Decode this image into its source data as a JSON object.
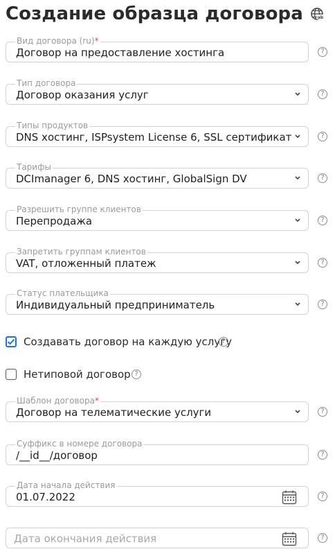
{
  "page_title": "Создание образца договора",
  "fields": [
    {
      "label": "Вид договора (ru)",
      "required": "*",
      "value": "Договор на предоставление хостинга",
      "type": "text"
    },
    {
      "label": "Тип договора",
      "value": "Договор оказания услуг",
      "type": "select"
    },
    {
      "label": "Типы продуктов",
      "value": "DNS хостинг, ISPsystem License 6, SSL сертификат",
      "type": "select"
    },
    {
      "label": "Тарифы",
      "value": "DCImanager 6, DNS хостинг, GlobalSign DV",
      "type": "select"
    },
    {
      "label": "Разрешить группе клиентов",
      "value": "Перепродажа",
      "type": "select"
    },
    {
      "label": "Запретить группам клиентов",
      "value": "VAT, отложенный платеж",
      "type": "select"
    },
    {
      "label": "Статус плательщика",
      "value": "Индивидуальный предприниматель",
      "type": "select"
    }
  ],
  "checkboxes": [
    {
      "label": "Создавать договор на каждую услугу",
      "checked": true
    },
    {
      "label": "Нетиповой договор",
      "checked": false
    }
  ],
  "template_field": {
    "label": "Шаблон договора",
    "required": "*",
    "value": "Договор на телематические услуги",
    "type": "select"
  },
  "suffix_field": {
    "label": "Суффикс в номере договора",
    "value": "/__id__/договор",
    "type": "text"
  },
  "start_date_field": {
    "label": "Дата начала действия",
    "value": "01.07.2022",
    "type": "date"
  },
  "end_date_field": {
    "placeholder": "Дата окончания действия",
    "type": "date"
  },
  "help_symbol": "?",
  "colors": {
    "accent": "#1a73e8",
    "required": "#e0454e",
    "border": "#d3d3d3",
    "label": "#9a9a9a"
  },
  "icons": {
    "title": "globe-icon",
    "select": "chevron-down-icon",
    "date": "calendar-icon",
    "help": "help-icon"
  }
}
